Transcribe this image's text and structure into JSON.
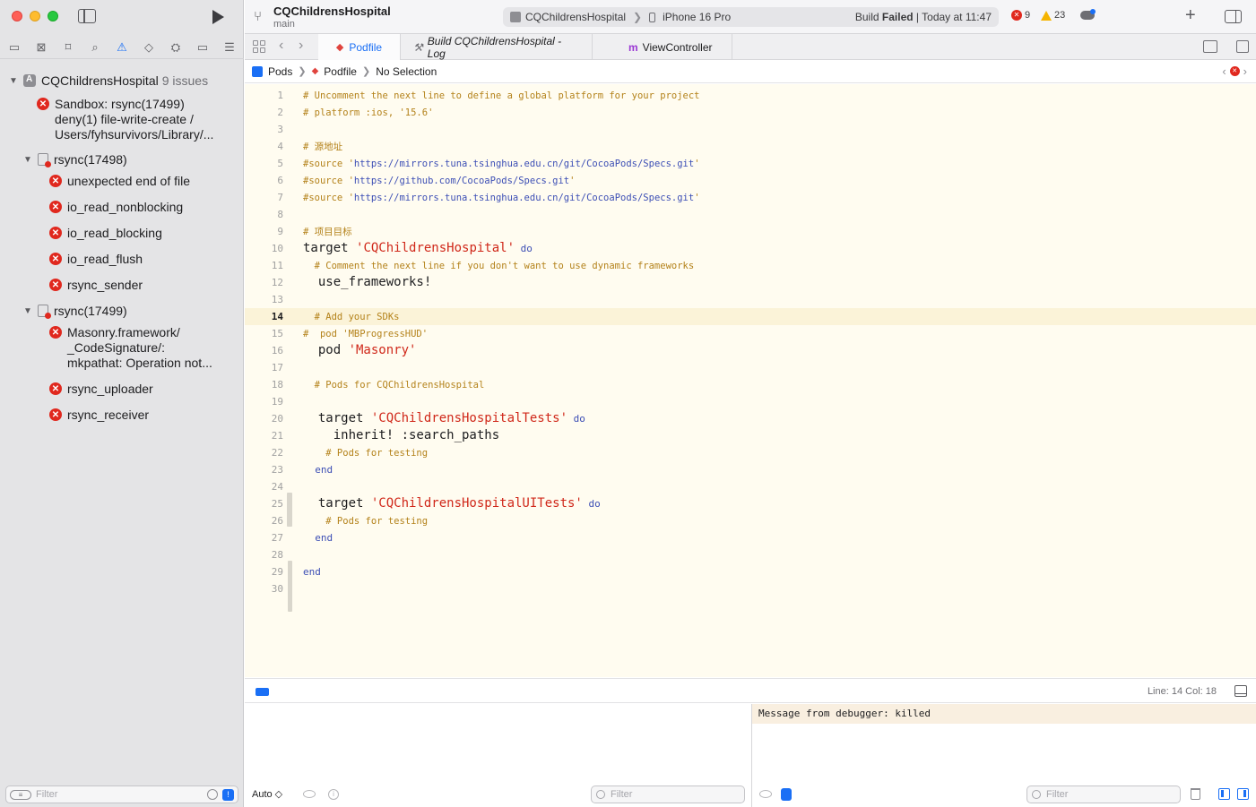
{
  "window": {
    "project_name": "CQChildrensHospital",
    "branch": "main"
  },
  "activity": {
    "scheme": "CQChildrensHospital",
    "destination": "iPhone 16 Pro",
    "build_label": "Build",
    "build_result": "Failed",
    "build_time": "| Today at 11:47",
    "error_count": "9",
    "warning_count": "23"
  },
  "sidebar": {
    "root": {
      "label": "CQChildrensHospital",
      "count": "9 issues"
    },
    "items": [
      {
        "kind": "issue",
        "lines": [
          "Sandbox: rsync(17499)",
          "deny(1) file-write-create /",
          "Users/fyhsurvivors/Library/..."
        ]
      },
      {
        "kind": "group",
        "label": "rsync(17498)"
      },
      {
        "kind": "issue",
        "lines": [
          "unexpected end of file"
        ]
      },
      {
        "kind": "issue",
        "lines": [
          "io_read_nonblocking"
        ]
      },
      {
        "kind": "issue",
        "lines": [
          "io_read_blocking"
        ]
      },
      {
        "kind": "issue",
        "lines": [
          "io_read_flush"
        ]
      },
      {
        "kind": "issue",
        "lines": [
          "rsync_sender"
        ]
      },
      {
        "kind": "group",
        "label": "rsync(17499)"
      },
      {
        "kind": "issue",
        "lines": [
          "Masonry.framework/",
          "_CodeSignature/:",
          "mkpathat: Operation not..."
        ]
      },
      {
        "kind": "issue",
        "lines": [
          "rsync_uploader"
        ]
      },
      {
        "kind": "issue",
        "lines": [
          "rsync_receiver"
        ]
      }
    ],
    "filter_placeholder": "Filter"
  },
  "tabs": [
    {
      "label": "Podfile",
      "icon": "ruby-icon",
      "active": true
    },
    {
      "label": "Build CQChildrensHospital - Log",
      "icon": "hammer-icon",
      "active": false
    },
    {
      "label": "ViewController",
      "icon": "m-file-icon",
      "active": false
    }
  ],
  "jumpbar": {
    "crumbs": [
      "Pods",
      "Podfile",
      "No Selection"
    ]
  },
  "editor": {
    "current_line": 14,
    "lines": [
      {
        "n": 1,
        "segs": [
          [
            "c",
            "# Uncomment the next line to define a global platform for your project"
          ]
        ]
      },
      {
        "n": 2,
        "segs": [
          [
            "c",
            "# platform :ios, '15.6'"
          ]
        ]
      },
      {
        "n": 3,
        "segs": []
      },
      {
        "n": 4,
        "segs": [
          [
            "c",
            "# 源地址"
          ]
        ]
      },
      {
        "n": 5,
        "segs": [
          [
            "c",
            "#source '"
          ],
          [
            "u",
            "https://mirrors.tuna.tsinghua.edu.cn/git/CocoaPods/Specs.git"
          ],
          [
            "c",
            "'"
          ]
        ]
      },
      {
        "n": 6,
        "segs": [
          [
            "c",
            "#source '"
          ],
          [
            "u",
            "https://github.com/CocoaPods/Specs.git"
          ],
          [
            "c",
            "'"
          ]
        ]
      },
      {
        "n": 7,
        "segs": [
          [
            "c",
            "#source '"
          ],
          [
            "u",
            "https://mirrors.tuna.tsinghua.edu.cn/git/CocoaPods/Specs.git"
          ],
          [
            "c",
            "'"
          ]
        ]
      },
      {
        "n": 8,
        "segs": []
      },
      {
        "n": 9,
        "segs": [
          [
            "c",
            "# 项目目标"
          ]
        ]
      },
      {
        "n": 10,
        "segs": [
          [
            "k",
            "target "
          ],
          [
            "s",
            "'CQChildrensHospital'"
          ],
          [
            "d",
            " do"
          ]
        ]
      },
      {
        "n": 11,
        "segs": [
          [
            "c",
            "  # Comment the next line if you don't want to use dynamic frameworks"
          ]
        ]
      },
      {
        "n": 12,
        "segs": [
          [
            "k",
            "  use_frameworks!"
          ]
        ]
      },
      {
        "n": 13,
        "segs": []
      },
      {
        "n": 14,
        "segs": [
          [
            "c",
            "  # Add your SDKs"
          ]
        ]
      },
      {
        "n": 15,
        "segs": [
          [
            "c",
            "#  pod 'MBProgressHUD'"
          ]
        ]
      },
      {
        "n": 16,
        "segs": [
          [
            "k",
            "  pod "
          ],
          [
            "s",
            "'Masonry'"
          ]
        ]
      },
      {
        "n": 17,
        "segs": []
      },
      {
        "n": 18,
        "segs": [
          [
            "c",
            "  # Pods for CQChildrensHospital"
          ]
        ]
      },
      {
        "n": 19,
        "segs": []
      },
      {
        "n": 20,
        "segs": [
          [
            "k",
            "  target "
          ],
          [
            "s",
            "'CQChildrensHospitalTests'"
          ],
          [
            "d",
            " do"
          ]
        ]
      },
      {
        "n": 21,
        "segs": [
          [
            "k",
            "    inherit! :search_paths"
          ]
        ]
      },
      {
        "n": 22,
        "segs": [
          [
            "c",
            "    # Pods for testing"
          ]
        ]
      },
      {
        "n": 23,
        "segs": [
          [
            "d",
            "  end"
          ]
        ]
      },
      {
        "n": 24,
        "segs": []
      },
      {
        "n": 25,
        "segs": [
          [
            "k",
            "  target "
          ],
          [
            "s",
            "'CQChildrensHospitalUITests'"
          ],
          [
            "d",
            " do"
          ]
        ]
      },
      {
        "n": 26,
        "segs": [
          [
            "c",
            "    # Pods for testing"
          ]
        ]
      },
      {
        "n": 27,
        "segs": [
          [
            "d",
            "  end"
          ]
        ]
      },
      {
        "n": 28,
        "segs": []
      },
      {
        "n": 29,
        "segs": [
          [
            "d",
            "end"
          ]
        ]
      },
      {
        "n": 30,
        "segs": []
      }
    ]
  },
  "status": {
    "line_col": "Line: 14  Col: 18"
  },
  "debug": {
    "variables_mode": "Auto ◇",
    "variables_filter_placeholder": "Filter",
    "console_message": "Message from debugger: killed",
    "console_filter_placeholder": "Filter"
  },
  "colors": {
    "accent": "#1a6ff5",
    "error": "#e0281e",
    "warning": "#f5b400",
    "editor_bg": "#fffcf0",
    "comment": "#b4821a",
    "string": "#d0281a"
  }
}
